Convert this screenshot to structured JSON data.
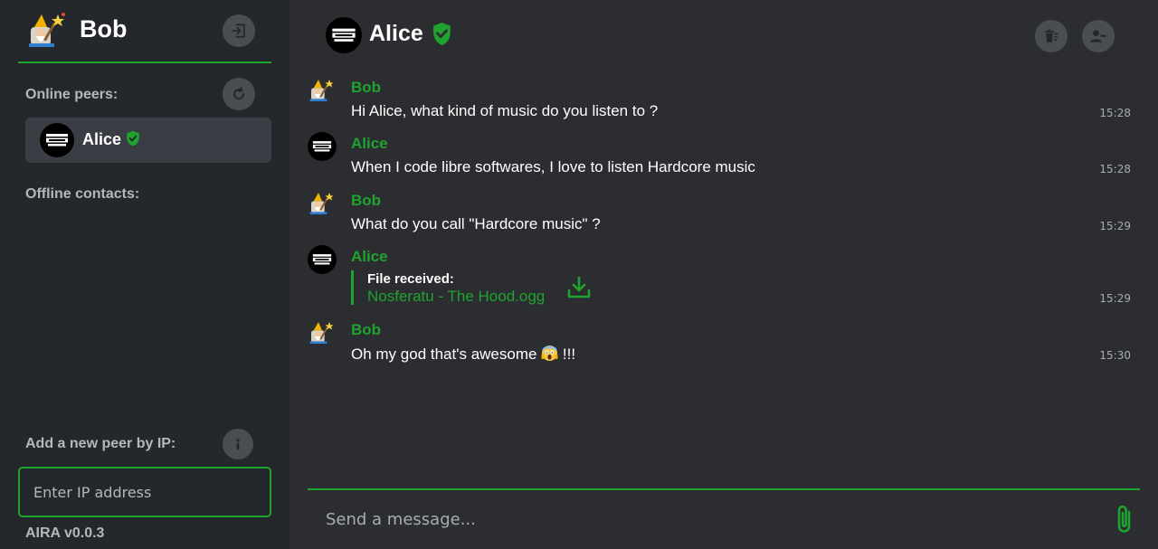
{
  "me": {
    "name": "Bob",
    "avatar_icon": "wizard-avatar"
  },
  "sidebar": {
    "online_label": "Online peers:",
    "offline_label": "Offline contacts:",
    "add_peer_label": "Add a new peer by IP:",
    "ip_placeholder": "Enter IP address",
    "version": "AIRA v0.0.3",
    "online_peers": [
      {
        "name": "Alice",
        "verified": true,
        "avatar_icon": "parental-advisory-avatar"
      }
    ]
  },
  "chat": {
    "peer_name": "Alice",
    "peer_verified": true,
    "message_placeholder": "Send a message...",
    "messages": [
      {
        "sender": "Bob",
        "text": "Hi Alice, what kind of music do you listen to ?",
        "time": "15:28"
      },
      {
        "sender": "Alice",
        "text": "When I code libre softwares, I love to listen Hardcore music",
        "time": "15:28"
      },
      {
        "sender": "Bob",
        "text": "What do you call \"Hardcore music\" ?",
        "time": "15:29"
      },
      {
        "sender": "Alice",
        "file_label": "File received:",
        "file_name": "Nosferatu - The Hood.ogg",
        "time": "15:29"
      },
      {
        "sender": "Bob",
        "text_before_emoji": "Oh my god that's awesome ",
        "emoji": "screaming-face-emoji",
        "text_after_emoji": " !!!",
        "time": "15:30"
      }
    ]
  },
  "colors": {
    "accent": "#1fa32f",
    "sidebar_bg": "#24272c",
    "chat_bg": "#2b2d31",
    "button_bg": "#4a4d52",
    "muted_text": "#b4b8bd"
  }
}
